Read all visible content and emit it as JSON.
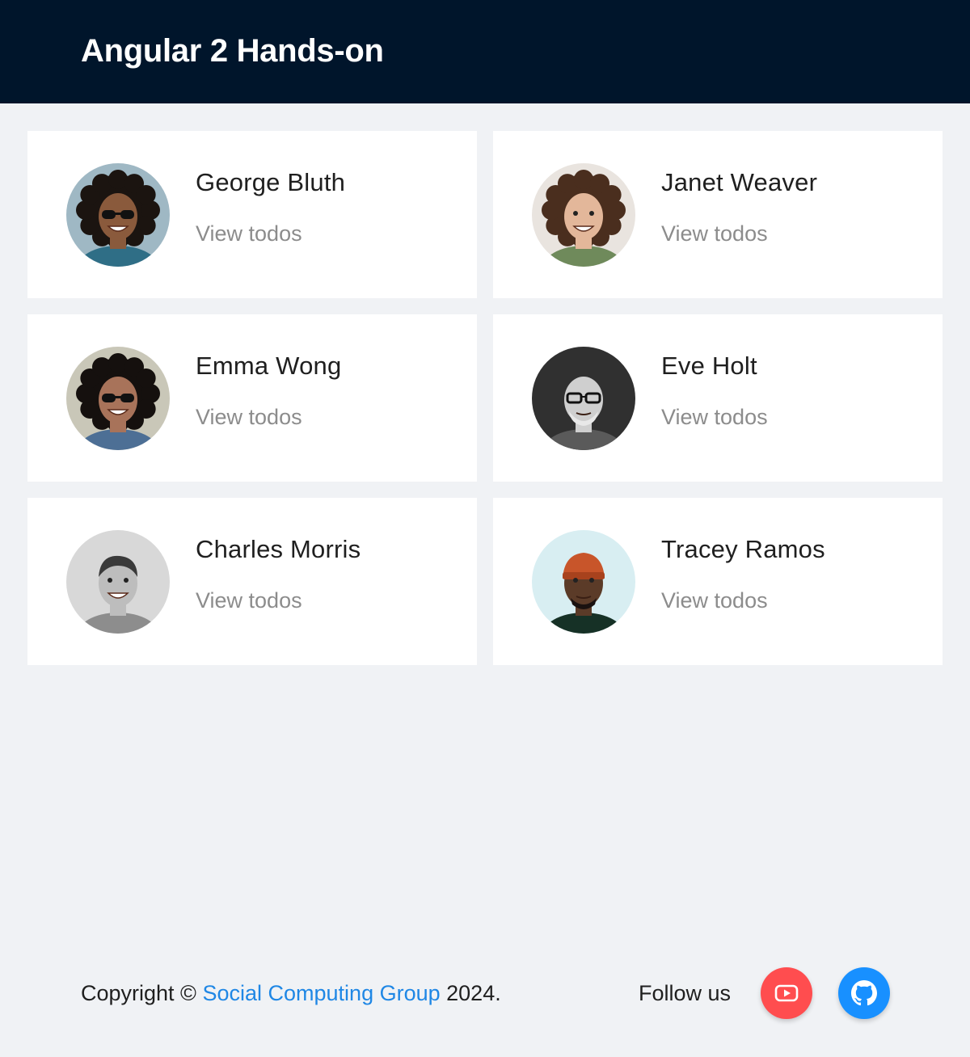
{
  "header": {
    "title": "Angular 2 Hands-on"
  },
  "users": [
    {
      "name": "George Bluth",
      "link": "View todos",
      "avatar": "avatar-curly-hair-sunglasses",
      "bg": "#9fb8c4",
      "skin": "#8a5a3c",
      "hair": "#1b1410",
      "shirt": "#2f6e86"
    },
    {
      "name": "Janet Weaver",
      "link": "View todos",
      "avatar": "avatar-wavy-hair-smiling",
      "bg": "#e9e4df",
      "skin": "#e3b79a",
      "hair": "#4a2e1e",
      "shirt": "#6f8a5b"
    },
    {
      "name": "Emma Wong",
      "link": "View todos",
      "avatar": "avatar-curly-hair-sunglasses",
      "bg": "#c9c7b8",
      "skin": "#a8735a",
      "hair": "#15100e",
      "shirt": "#4d6f95"
    },
    {
      "name": "Eve Holt",
      "link": "View todos",
      "avatar": "avatar-bald-glasses-bw",
      "bg": "#303030",
      "skin": "#cfcfcf",
      "hair": "#e8e8e8",
      "shirt": "#5a5a5a"
    },
    {
      "name": "Charles Morris",
      "link": "View todos",
      "avatar": "avatar-short-hair-bw",
      "bg": "#d8d8d8",
      "skin": "#bdbdbd",
      "hair": "#3a3a3a",
      "shirt": "#8d8d8d"
    },
    {
      "name": "Tracey Ramos",
      "link": "View todos",
      "avatar": "avatar-orange-beanie",
      "bg": "#d8eef2",
      "skin": "#5b3b28",
      "hair": "#c8552a",
      "shirt": "#163126"
    }
  ],
  "footer": {
    "copyright_prefix": "Copyright ©",
    "copyright_link": "Social Computing Group",
    "copyright_suffix": "2024.",
    "follow_label": "Follow us",
    "youtube_icon": "youtube-icon",
    "github_icon": "github-icon",
    "youtube_color": "#ff4d4f",
    "github_color": "#1890ff"
  }
}
